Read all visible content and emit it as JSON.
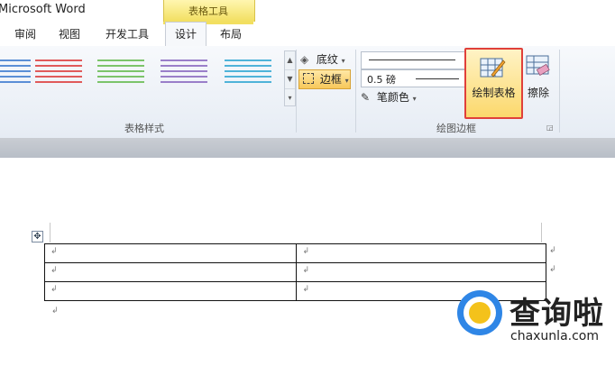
{
  "window": {
    "title": "Microsoft Word",
    "context_tab_group": "表格工具"
  },
  "tabs": [
    {
      "label": "审阅"
    },
    {
      "label": "视图"
    },
    {
      "label": "开发工具"
    },
    {
      "label": "设计",
      "active": true
    },
    {
      "label": "布局"
    }
  ],
  "ribbon": {
    "table_styles_group": {
      "label": "表格样式",
      "accent_colors": [
        "#5b8fd6",
        "#e05a5a",
        "#7cc46a",
        "#9a7fc9",
        "#4fb3d9"
      ]
    },
    "shading_label": "底纹",
    "border_label": "边框",
    "draw_borders_group": {
      "label": "绘图边框",
      "line_weight": "0.5 磅",
      "pen_color_label": "笔颜色",
      "draw_table_label": "绘制表格",
      "eraser_label": "擦除"
    }
  },
  "document": {
    "rows": [
      [
        "↲",
        "↲"
      ],
      [
        "↲",
        "↲"
      ],
      [
        "↲",
        "↲"
      ]
    ],
    "row_end_mark": "↲",
    "paragraph_mark": "↲"
  },
  "watermark": {
    "name": "查询啦",
    "domain": "chaxunla.com"
  },
  "colors": {
    "highlight_border": "#e0403a",
    "context_tab": "#f2df60",
    "logo_blue": "#2f86e6",
    "logo_yellow": "#f4c21b"
  }
}
